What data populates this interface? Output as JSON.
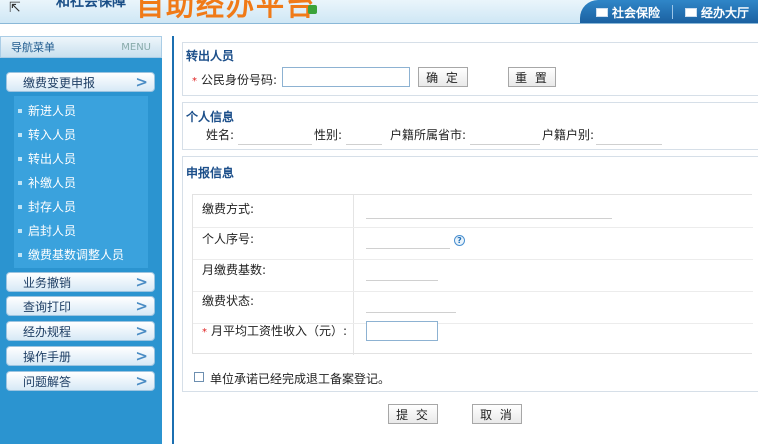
{
  "header": {
    "brand_small": "和社会保障",
    "brand_large": "自助经办平台",
    "links": [
      {
        "label": "社会保险",
        "icon": "monitor-icon"
      },
      {
        "label": "经办大厅",
        "icon": "building-icon"
      }
    ]
  },
  "sidebar": {
    "title": "导航菜单",
    "menu_label": "MENU",
    "groups": [
      {
        "label": "缴费变更申报",
        "icon": "chevron-right-icon"
      },
      {
        "label": "业务撤销",
        "icon": "chevron-right-icon"
      },
      {
        "label": "查询打印",
        "icon": "chevron-right-icon"
      },
      {
        "label": "经办规程",
        "icon": "chevron-right-icon"
      },
      {
        "label": "操作手册",
        "icon": "chevron-right-icon"
      },
      {
        "label": "问题解答",
        "icon": "chevron-right-icon"
      }
    ],
    "sub_items": [
      "新进人员",
      "转入人员",
      "转出人员",
      "补缴人员",
      "封存人员",
      "启封人员",
      "缴费基数调整人员"
    ]
  },
  "form": {
    "transfer_out": {
      "title": "转出人员",
      "required_mark": "*",
      "id_label": "公民身份号码:",
      "id_value": "",
      "confirm_button": "确 定",
      "reset_button": "重 置"
    },
    "personal": {
      "title": "个人信息",
      "name_label": "姓名:",
      "gender_label": "性别:",
      "province_label": "户籍所属省市:",
      "hukou_label": "户籍户别:"
    },
    "declaration": {
      "title": "申报信息",
      "payment_method_label": "缴费方式:",
      "seq_label": "个人序号:",
      "monthly_base_label": "月缴费基数:",
      "status_label": "缴费状态:",
      "required_mark": "*",
      "avg_salary_label": "月平均工资性收入（元）:",
      "avg_salary_value": "",
      "help_icon": "question-icon"
    },
    "commit_checkbox_label": "单位承诺已经完成退工备案登记。",
    "submit_button": "提 交",
    "cancel_button": "取 消"
  },
  "colors": {
    "sidebar_bg": "#2b94d0",
    "section_title": "#1c4f8a",
    "brand_orange": "#f07a17",
    "required": "#e02020"
  }
}
